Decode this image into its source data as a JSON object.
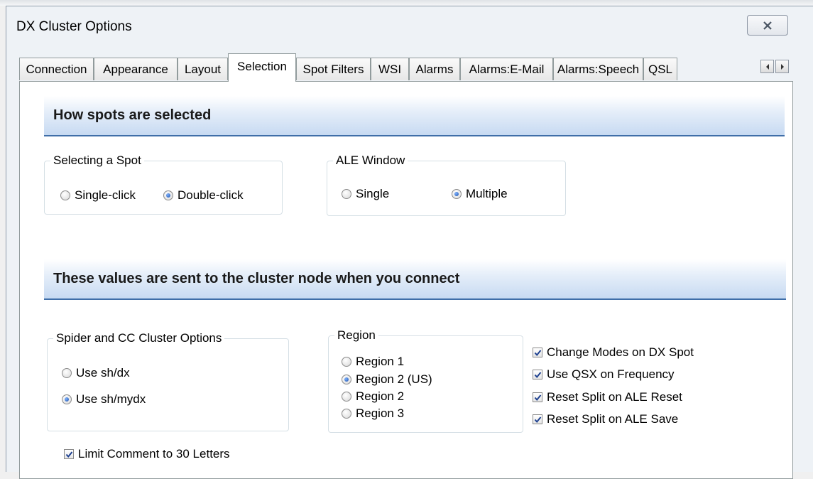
{
  "window": {
    "title": "DX Cluster Options"
  },
  "tabs": [
    {
      "label": "Connection"
    },
    {
      "label": "Appearance"
    },
    {
      "label": "Layout"
    },
    {
      "label": "Selection",
      "active": true
    },
    {
      "label": "Spot Filters"
    },
    {
      "label": "WSI"
    },
    {
      "label": "Alarms"
    },
    {
      "label": "Alarms:E-Mail"
    },
    {
      "label": "Alarms:Speech"
    },
    {
      "label": "QSL"
    }
  ],
  "sections": {
    "selection_header": "How spots are selected",
    "cluster_header": "These values are sent to the cluster node when you connect"
  },
  "selecting_spot": {
    "legend": "Selecting a Spot",
    "options": [
      {
        "label": "Single-click",
        "checked": false
      },
      {
        "label": "Double-click",
        "checked": true
      }
    ]
  },
  "ale_window": {
    "legend": "ALE Window",
    "options": [
      {
        "label": "Single",
        "checked": false
      },
      {
        "label": "Multiple",
        "checked": true
      }
    ]
  },
  "spider_options": {
    "legend": "Spider and CC Cluster Options",
    "options": [
      {
        "label": "Use sh/dx",
        "checked": false
      },
      {
        "label": "Use sh/mydx",
        "checked": true
      }
    ]
  },
  "region": {
    "legend": "Region",
    "options": [
      {
        "label": "Region 1",
        "checked": false
      },
      {
        "label": "Region 2 (US)",
        "checked": true
      },
      {
        "label": "Region 2",
        "checked": false
      },
      {
        "label": "Region 3",
        "checked": false
      }
    ]
  },
  "checks": [
    {
      "label": "Change Modes on DX Spot",
      "checked": true
    },
    {
      "label": "Use QSX on Frequency",
      "checked": true
    },
    {
      "label": "Reset Split on ALE Reset",
      "checked": true
    },
    {
      "label": "Reset Split on ALE Save",
      "checked": true
    }
  ],
  "limit_comment": {
    "label": "Limit Comment to 30 Letters",
    "checked": true
  },
  "icons": {
    "close": "close-icon",
    "scroll_left": "arrow-left-icon",
    "scroll_right": "arrow-right-icon"
  },
  "colors": {
    "header_border": "#3f6ea8",
    "header_gradient_end": "#c7daf2"
  }
}
